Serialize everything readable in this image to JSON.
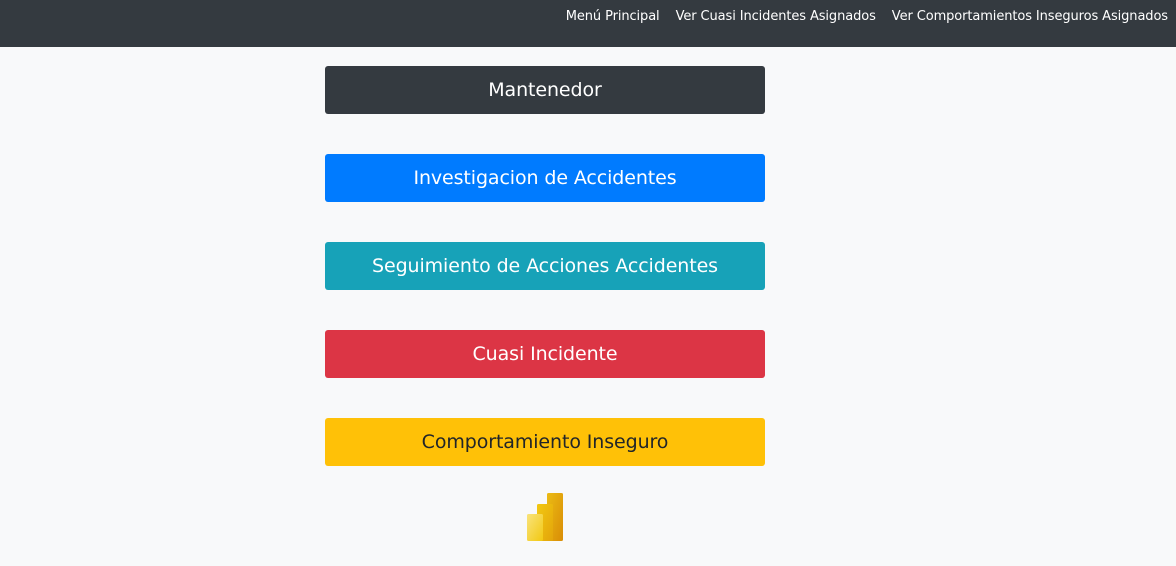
{
  "nav": {
    "items": [
      {
        "label": "Menú Principal"
      },
      {
        "label": "Ver Cuasi Incidentes Asignados"
      },
      {
        "label": "Ver Comportamientos Inseguros Asignados"
      }
    ]
  },
  "buttons": [
    {
      "label": "Mantenedor",
      "bg": "#343a40",
      "fg": "#ffffff"
    },
    {
      "label": "Investigacion de Accidentes",
      "bg": "#007bff",
      "fg": "#ffffff"
    },
    {
      "label": "Seguimiento de Acciones Accidentes",
      "bg": "#17a2b8",
      "fg": "#ffffff"
    },
    {
      "label": "Cuasi Incidente",
      "bg": "#dc3545",
      "fg": "#ffffff"
    },
    {
      "label": "Comportamiento Inseguro",
      "bg": "#ffc107",
      "fg": "#212529"
    }
  ],
  "logo": {
    "icon": "power-bi-icon"
  }
}
